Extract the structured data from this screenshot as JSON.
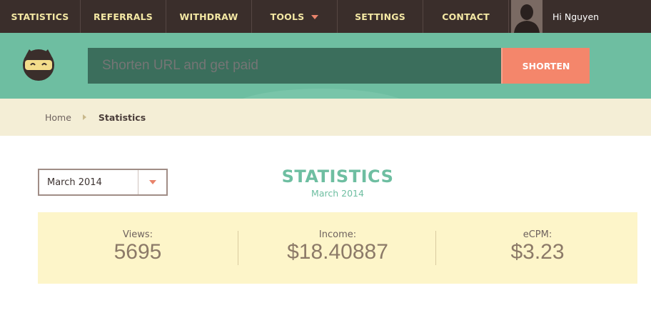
{
  "nav": {
    "items": [
      {
        "label": "STATISTICS"
      },
      {
        "label": "REFERRALS"
      },
      {
        "label": "WITHDRAW"
      },
      {
        "label": "TOOLS"
      },
      {
        "label": "SETTINGS"
      },
      {
        "label": "CONTACT"
      }
    ],
    "user_greeting": "Hi Nguyen"
  },
  "header": {
    "url_placeholder": "Shorten URL and get paid",
    "shorten_label": "SHORTEN"
  },
  "breadcrumb": {
    "home": "Home",
    "current": "Statistics"
  },
  "filter": {
    "selected_month": "March 2014"
  },
  "page": {
    "title": "STATISTICS",
    "subtitle": "March 2014"
  },
  "stats": [
    {
      "label": "Views:",
      "value": "5695"
    },
    {
      "label": "Income:",
      "value": "$18.40887"
    },
    {
      "label": "eCPM:",
      "value": "$3.23"
    }
  ],
  "colors": {
    "nav_bg": "#3a2e2b",
    "nav_text": "#f4e8a4",
    "accent_green": "#6ebea1",
    "search_bg": "#3b6e5c",
    "button_orange": "#f4866b",
    "breadcrumb_bg": "#f4eed6",
    "stats_bg": "#fdf5c9"
  }
}
